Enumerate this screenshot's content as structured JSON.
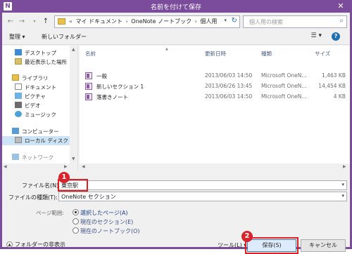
{
  "window": {
    "title": "名前を付けて保存",
    "app_icon": "N",
    "accent_color": "#7c4c9c"
  },
  "address": {
    "prefix": "«",
    "crumbs": [
      "マイ ドキュメント",
      "OneNote ノートブック",
      "個人用"
    ],
    "separator": "›",
    "search_placeholder": "個人用の検索"
  },
  "toolbar": {
    "organize": "整理 ▾",
    "new_folder": "新しいフォルダー"
  },
  "nav": {
    "items": [
      {
        "label": "デスクトップ",
        "icon": "desktop-icon"
      },
      {
        "label": "最近表示した場所",
        "icon": "recent-places-icon"
      },
      {
        "label": "ライブラリ",
        "icon": "library-icon"
      },
      {
        "label": "ドキュメント",
        "icon": "documents-icon"
      },
      {
        "label": "ピクチャ",
        "icon": "pictures-icon"
      },
      {
        "label": "ビデオ",
        "icon": "videos-icon"
      },
      {
        "label": "ミュージック",
        "icon": "music-icon"
      },
      {
        "label": "コンピューター",
        "icon": "computer-icon"
      },
      {
        "label": "ローカル ディスク (C",
        "icon": "local-disk-icon"
      },
      {
        "label": "ネットワーク",
        "icon": "network-icon"
      }
    ]
  },
  "files": {
    "columns": [
      "名前",
      "更新日時",
      "種類",
      "サイズ"
    ],
    "rows": [
      {
        "name": "一般",
        "date": "2013/06/03 14:50",
        "type": "Microsoft OneN...",
        "size": "1,463 KB"
      },
      {
        "name": "新しいセクション 1",
        "date": "2013/06/26 13:45",
        "type": "Microsoft OneN...",
        "size": "14,454 KB"
      },
      {
        "name": "落書きノート",
        "date": "2013/06/03 14:50",
        "type": "Microsoft OneN...",
        "size": "4 KB"
      }
    ]
  },
  "form": {
    "filename_label": "ファイル名(N):",
    "filename_value": "東京駅",
    "filetype_label": "ファイルの種類(T):",
    "filetype_value": "OneNote セクション",
    "page_range_label": "ページ範囲:",
    "range_options": [
      "選択したページ(A)",
      "現在のセクション(E)",
      "現在のノートブック(O)"
    ],
    "range_selected_index": 0
  },
  "footer": {
    "hide_folders": "フォルダーの非表示",
    "tools": "ツール(L)",
    "save": "保存(S)",
    "cancel": "キャンセル"
  },
  "annotations": {
    "badge_1": "1",
    "badge_2": "2",
    "color": "#d9222a"
  }
}
